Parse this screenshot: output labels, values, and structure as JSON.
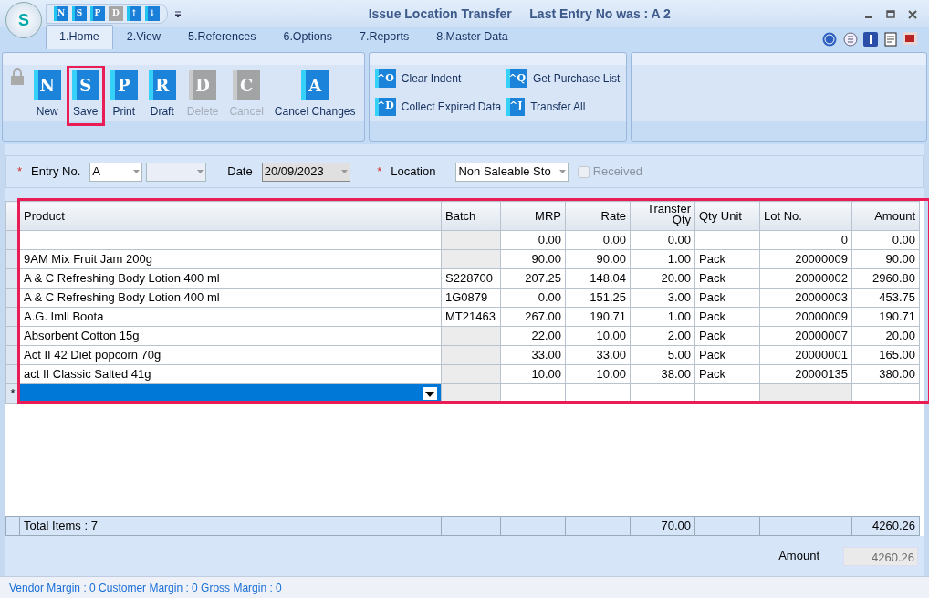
{
  "window": {
    "title": "Issue Location Transfer",
    "subtitle": "Last Entry No was : A 2",
    "logo_letter": "S"
  },
  "quick_access": [
    {
      "glyph": "N",
      "disabled": false
    },
    {
      "glyph": "S",
      "disabled": false
    },
    {
      "glyph": "P",
      "disabled": false
    },
    {
      "glyph": "D",
      "disabled": true
    },
    {
      "glyph": "↑",
      "disabled": false
    },
    {
      "glyph": "↓",
      "disabled": false
    }
  ],
  "tabs": [
    {
      "label": "1.Home",
      "selected": true
    },
    {
      "label": "2.View",
      "selected": false
    },
    {
      "label": "5.References",
      "selected": false
    },
    {
      "label": "6.Options",
      "selected": false
    },
    {
      "label": "7.Reports",
      "selected": false
    },
    {
      "label": "8.Master Data",
      "selected": false
    }
  ],
  "ribbon": {
    "main_buttons": [
      {
        "label": "New",
        "glyph": "N",
        "disabled": false,
        "highlighted": false
      },
      {
        "label": "Save",
        "glyph": "S",
        "disabled": false,
        "highlighted": true
      },
      {
        "label": "Print",
        "glyph": "P",
        "disabled": false,
        "highlighted": false
      },
      {
        "label": "Draft",
        "glyph": "R",
        "disabled": false,
        "highlighted": false
      },
      {
        "label": "Delete",
        "glyph": "D",
        "disabled": true,
        "highlighted": false
      },
      {
        "label": "Cancel",
        "glyph": "C",
        "disabled": true,
        "highlighted": false
      },
      {
        "label": "Cancel Changes",
        "glyph": "A",
        "disabled": false,
        "highlighted": false
      }
    ],
    "side_buttons": [
      {
        "label": "Clear Indent",
        "glyph": "^O"
      },
      {
        "label": "Collect Expired Data",
        "glyph": "^D"
      },
      {
        "label": "Get Purchase List",
        "glyph": "^Q"
      },
      {
        "label": "Transfer All",
        "glyph": "^J"
      }
    ]
  },
  "form": {
    "entry_label": "Entry No.",
    "entry_prefix": "A",
    "date_label": "Date",
    "date": "20/09/2023",
    "location_label": "Location",
    "location": "Non Saleable Sto",
    "received_label": "Received",
    "received": false,
    "required_mark": "*"
  },
  "grid": {
    "highlighted": true,
    "columns": [
      "Product",
      "Batch",
      "MRP",
      "Rate",
      "Transfer Qty",
      "Qty Unit",
      "Lot No.",
      "Amount"
    ],
    "rows": [
      {
        "cells": [
          null,
          null,
          "0.00",
          "0.00",
          "0.00",
          null,
          "0",
          "0.00"
        ]
      },
      {
        "cells": [
          "9AM Mix Fruit Jam 200g",
          null,
          "90.00",
          "90.00",
          "1.00",
          "Pack",
          "20000009",
          "90.00"
        ]
      },
      {
        "cells": [
          "A & C Refreshing Body Lotion 400 ml",
          "S228700",
          "207.25",
          "148.04",
          "20.00",
          "Pack",
          "20000002",
          "2960.80"
        ]
      },
      {
        "cells": [
          "A & C Refreshing Body Lotion 400 ml",
          "1G0879",
          "0.00",
          "151.25",
          "3.00",
          "Pack",
          "20000003",
          "453.75"
        ]
      },
      {
        "cells": [
          "A.G. Imli Boota",
          "MT21463",
          "267.00",
          "190.71",
          "1.00",
          "Pack",
          "20000009",
          "190.71"
        ]
      },
      {
        "cells": [
          "Absorbent Cotton 15g",
          null,
          "22.00",
          "10.00",
          "2.00",
          "Pack",
          "20000007",
          "20.00"
        ]
      },
      {
        "cells": [
          "Act II 42 Diet popcorn 70g",
          null,
          "33.00",
          "33.00",
          "5.00",
          "Pack",
          "20000001",
          "165.00"
        ]
      },
      {
        "cells": [
          "act II Classic Salted 41g",
          null,
          "10.00",
          "10.00",
          "38.00",
          "Pack",
          "20000135",
          "380.00"
        ]
      }
    ],
    "new_row_marker": "*",
    "totals": {
      "label": "Total Items : 7",
      "qty": "70.00",
      "amount": "4260.26"
    }
  },
  "amount": {
    "label": "Amount",
    "value": "4260.26"
  },
  "status_bar": "Vendor Margin : 0 Customer Margin : 0 Gross Margin : 0"
}
